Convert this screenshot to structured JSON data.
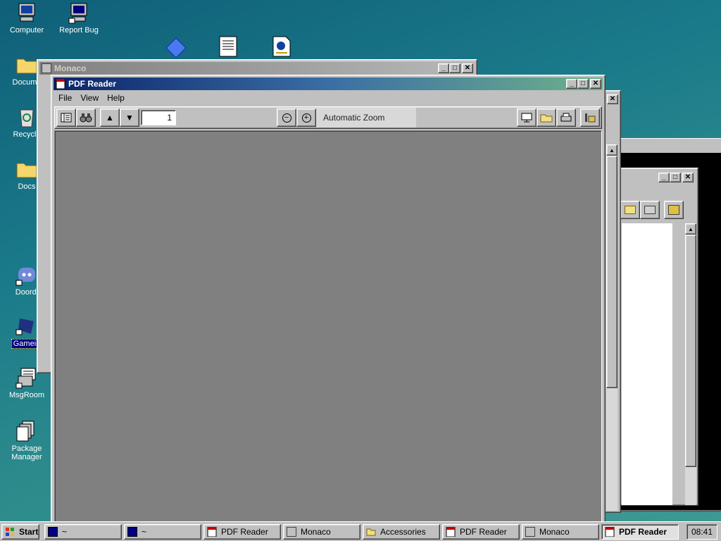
{
  "desktop": {
    "icons": [
      {
        "label": "Computer"
      },
      {
        "label": "Report Bug"
      },
      {
        "label": "Docume"
      },
      {
        "label": "Recycle"
      },
      {
        "label": "Docs"
      },
      {
        "label": "Doordi"
      },
      {
        "label": "Gamein"
      },
      {
        "label": "MsgRoom"
      },
      {
        "label": "Package Manager"
      }
    ]
  },
  "windows": {
    "monaco_bg": {
      "title": "Monaco"
    },
    "pdf_main": {
      "title": "PDF Reader",
      "menu": [
        "File",
        "View",
        "Help"
      ],
      "page_number": "1",
      "zoom_label": "Automatic Zoom"
    }
  },
  "taskbar": {
    "start_label": "Start",
    "items": [
      {
        "label": "~",
        "icon": "terminal-icon"
      },
      {
        "label": "~",
        "icon": "terminal-icon"
      },
      {
        "label": "PDF Reader",
        "icon": "pdf-icon"
      },
      {
        "label": "Monaco",
        "icon": "monaco-icon"
      },
      {
        "label": "Accessories",
        "icon": "folder-icon"
      },
      {
        "label": "PDF Reader",
        "icon": "pdf-icon"
      },
      {
        "label": "Monaco",
        "icon": "monaco-icon"
      },
      {
        "label": "PDF Reader",
        "icon": "pdf-icon"
      }
    ],
    "clock": "08:41"
  },
  "colors": {
    "title_active_start": "#0a246a",
    "viewer_bg": "#808080",
    "face": "#c0c0c0"
  }
}
